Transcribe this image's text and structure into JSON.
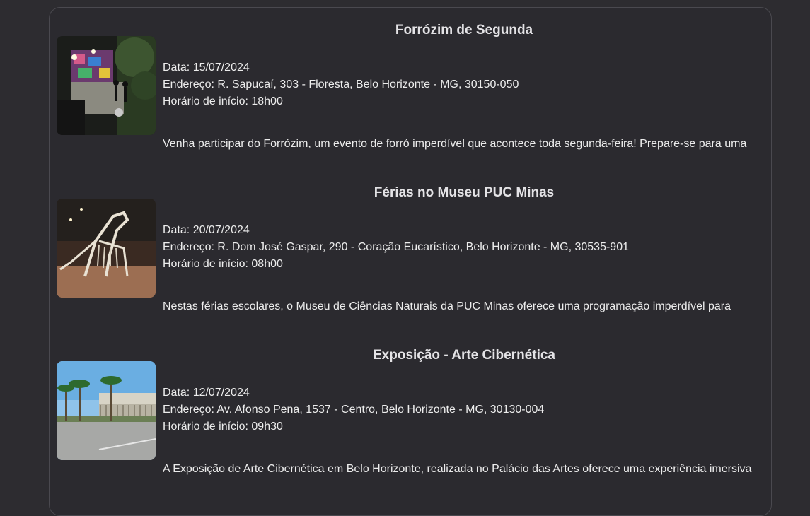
{
  "events": [
    {
      "title": "Forrózim de Segunda",
      "date": "Data: 15/07/2024",
      "address": "Endereço: R. Sapucaí, 303 - Floresta, Belo Horizonte - MG, 30150-050",
      "start": "Horário de início: 18h00",
      "description": "Venha participar do Forrózim, um evento de forró imperdível que acontece toda segunda-feira! Prepare-se para uma noite animada e cheia de música ao vivo."
    },
    {
      "title": "Férias no Museu PUC Minas",
      "date": "Data: 20/07/2024",
      "address": "Endereço: R. Dom José Gaspar, 290 - Coração Eucarístico, Belo Horizonte - MG, 30535-901",
      "start": "Horário de início: 08h00",
      "description": "Nestas férias escolares, o Museu de Ciências Naturais da PUC Minas oferece uma programação imperdível para crianças e famílias. As atividades incluem emocionantes escavações paleontológicas, onde os pequenos podem se"
    },
    {
      "title": "Exposição - Arte Cibernética",
      "date": "Data: 12/07/2024",
      "address": "Endereço: Av. Afonso Pena, 1537 - Centro, Belo Horizonte - MG, 30130-004",
      "start": "Horário de início: 09h30",
      "description": "A Exposição de Arte Cibernética em Belo Horizonte, realizada no Palácio das Artes oferece uma experiência imersiva na interseção entre arte e tecnologia."
    }
  ]
}
